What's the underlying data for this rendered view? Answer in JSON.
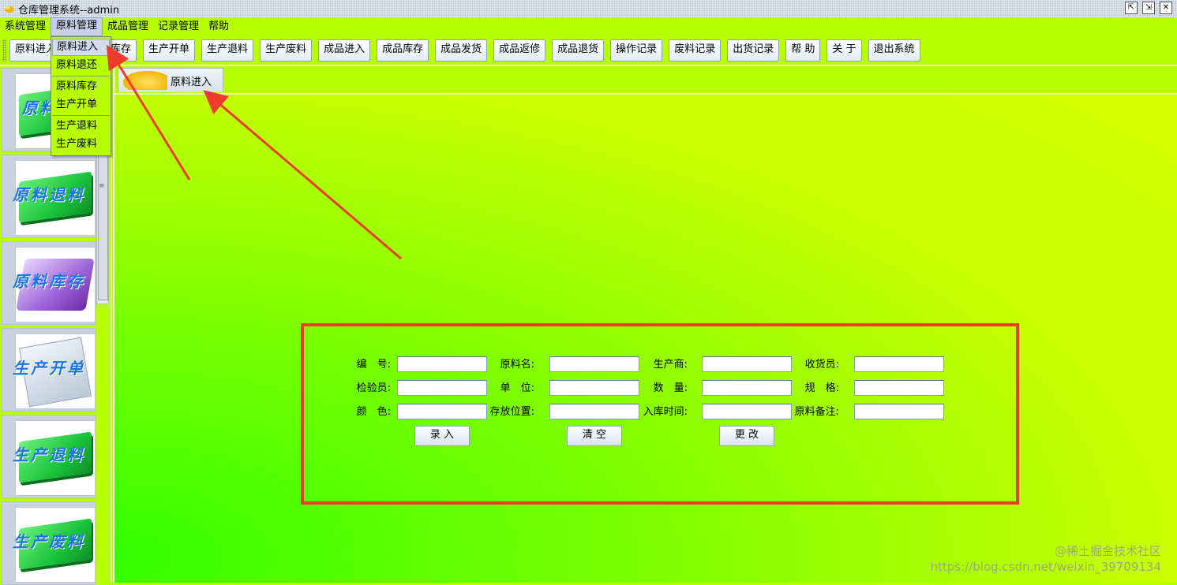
{
  "window": {
    "title": "仓库管理系统--admin",
    "buttons": [
      "⇱",
      "⇲",
      "✕"
    ]
  },
  "menubar": {
    "items": [
      {
        "label": "系统管理"
      },
      {
        "label": "原料管理",
        "active": true
      },
      {
        "label": "成品管理"
      },
      {
        "label": "记录管理"
      },
      {
        "label": "帮助"
      }
    ]
  },
  "dropdown": {
    "items": [
      "原料进入",
      "原料退还",
      "原料库存",
      "生产开单",
      "生产退料",
      "生产废料"
    ],
    "selected": "原料进入"
  },
  "toolbar": {
    "buttons": [
      "原料进入",
      "料",
      "原料库存",
      "生产开单",
      "生产退料",
      "生产废料",
      "成品进入",
      "成品库存",
      "成品发货",
      "成品返修",
      "成品退货",
      "操作记录",
      "废料记录",
      "出货记录",
      "帮 助",
      "关 于",
      "退出系统"
    ]
  },
  "sidebar": {
    "panels": [
      {
        "label": "原料进",
        "icon": "green-book-icon"
      },
      {
        "label": "原料退料",
        "icon": "green-book-icon"
      },
      {
        "label": "原料库存",
        "icon": "purple-folder-icon"
      },
      {
        "label": "生产开单",
        "icon": "document-icon"
      },
      {
        "label": "生产退料",
        "icon": "green-book-icon"
      },
      {
        "label": "生产废料",
        "icon": "green-book-icon"
      }
    ]
  },
  "tab": {
    "label": "原料进入",
    "icon": "leaf-icon"
  },
  "form": {
    "rows": [
      [
        {
          "label": "编　号:"
        },
        {
          "label": "原料名:"
        },
        {
          "label": "生产商:"
        },
        {
          "label": "收货员:"
        }
      ],
      [
        {
          "label": "检验员:"
        },
        {
          "label": "单　位:"
        },
        {
          "label": "数　量:"
        },
        {
          "label": "规　格:"
        }
      ],
      [
        {
          "label": "颜　色:"
        },
        {
          "label": "存放位置:"
        },
        {
          "label": "入库时间:"
        },
        {
          "label": "原料备注:"
        }
      ]
    ],
    "buttons": {
      "submit": "录 入",
      "clear": "清 空",
      "update": "更 改"
    }
  },
  "colors": {
    "background": "#b8ff00",
    "highlight_box": "#ee3b2c",
    "arrow": "#ee3b2c"
  },
  "watermark": {
    "line1": "@稀土掘金技术社区",
    "line2": "https://blog.csdn.net/weixin_39709134"
  }
}
